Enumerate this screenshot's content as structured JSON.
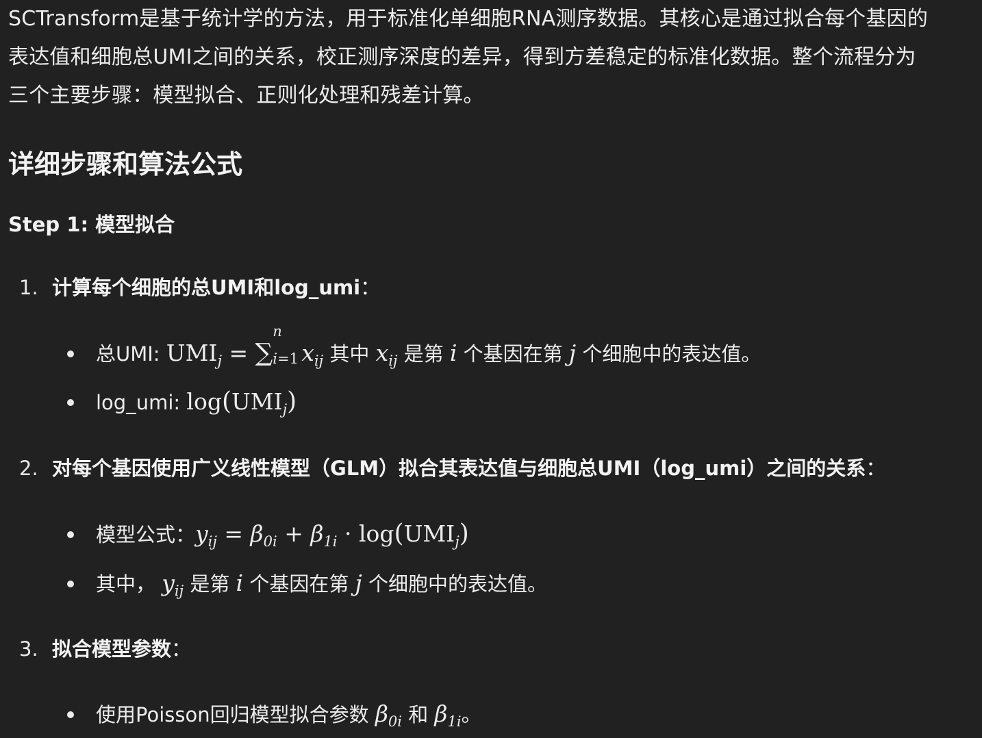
{
  "intro": {
    "line1": "SCTransform是基于统计学的方法，用于标准化单细胞RNA测序数据。其核心是通过拟合每个基因的",
    "line2": "表达值和细胞总UMI之间的关系，校正测序深度的差异，得到方差稳定的标准化数据。整个流程分为",
    "line3": "三个主要步骤：模型拟合、正则化处理和残差计算。"
  },
  "section_heading": "详细步骤和算法公式",
  "step1": {
    "title": "Step 1: 模型拟合",
    "items": [
      {
        "number": "1.",
        "text": "计算每个细胞的总UMI和log_umi",
        "colon": "：",
        "bullets": [
          {
            "label": "总UMI: ",
            "mid1": " 其中 ",
            "mid2": " 是第 ",
            "mid3": " 个基因在第 ",
            "tail": " 个细胞中的表达值。"
          },
          {
            "label": "log_umi: "
          }
        ]
      },
      {
        "number": "2.",
        "text": "对每个基因使用广义线性模型（GLM）拟合其表达值与细胞总UMI（log_umi）之间的关系",
        "colon": "：",
        "bullets": [
          {
            "label": "模型公式："
          },
          {
            "label": "其中， ",
            "mid1": " 是第 ",
            "mid2": " 个基因在第 ",
            "tail": " 个细胞中的表达值。"
          }
        ]
      },
      {
        "number": "3.",
        "text": "拟合模型参数",
        "colon": "：",
        "bullets": [
          {
            "label": "使用Poisson回归模型拟合参数 ",
            "mid1": " 和 ",
            "tail": "。"
          }
        ]
      }
    ]
  },
  "math": {
    "umi": "UMI",
    "sub_j": "j",
    "sub_ij": "ij",
    "sub_0i": "0i",
    "sub_1i": "1i",
    "eq": " = ",
    "plus": " + ",
    "cdot": " · ",
    "sum": "∑",
    "sum_upper": "n",
    "sum_lower": "i=1",
    "x": "x",
    "y": "y",
    "i": "i",
    "j": "j",
    "beta": "β",
    "log": "log",
    "lparen": "(",
    "rparen": ")"
  }
}
